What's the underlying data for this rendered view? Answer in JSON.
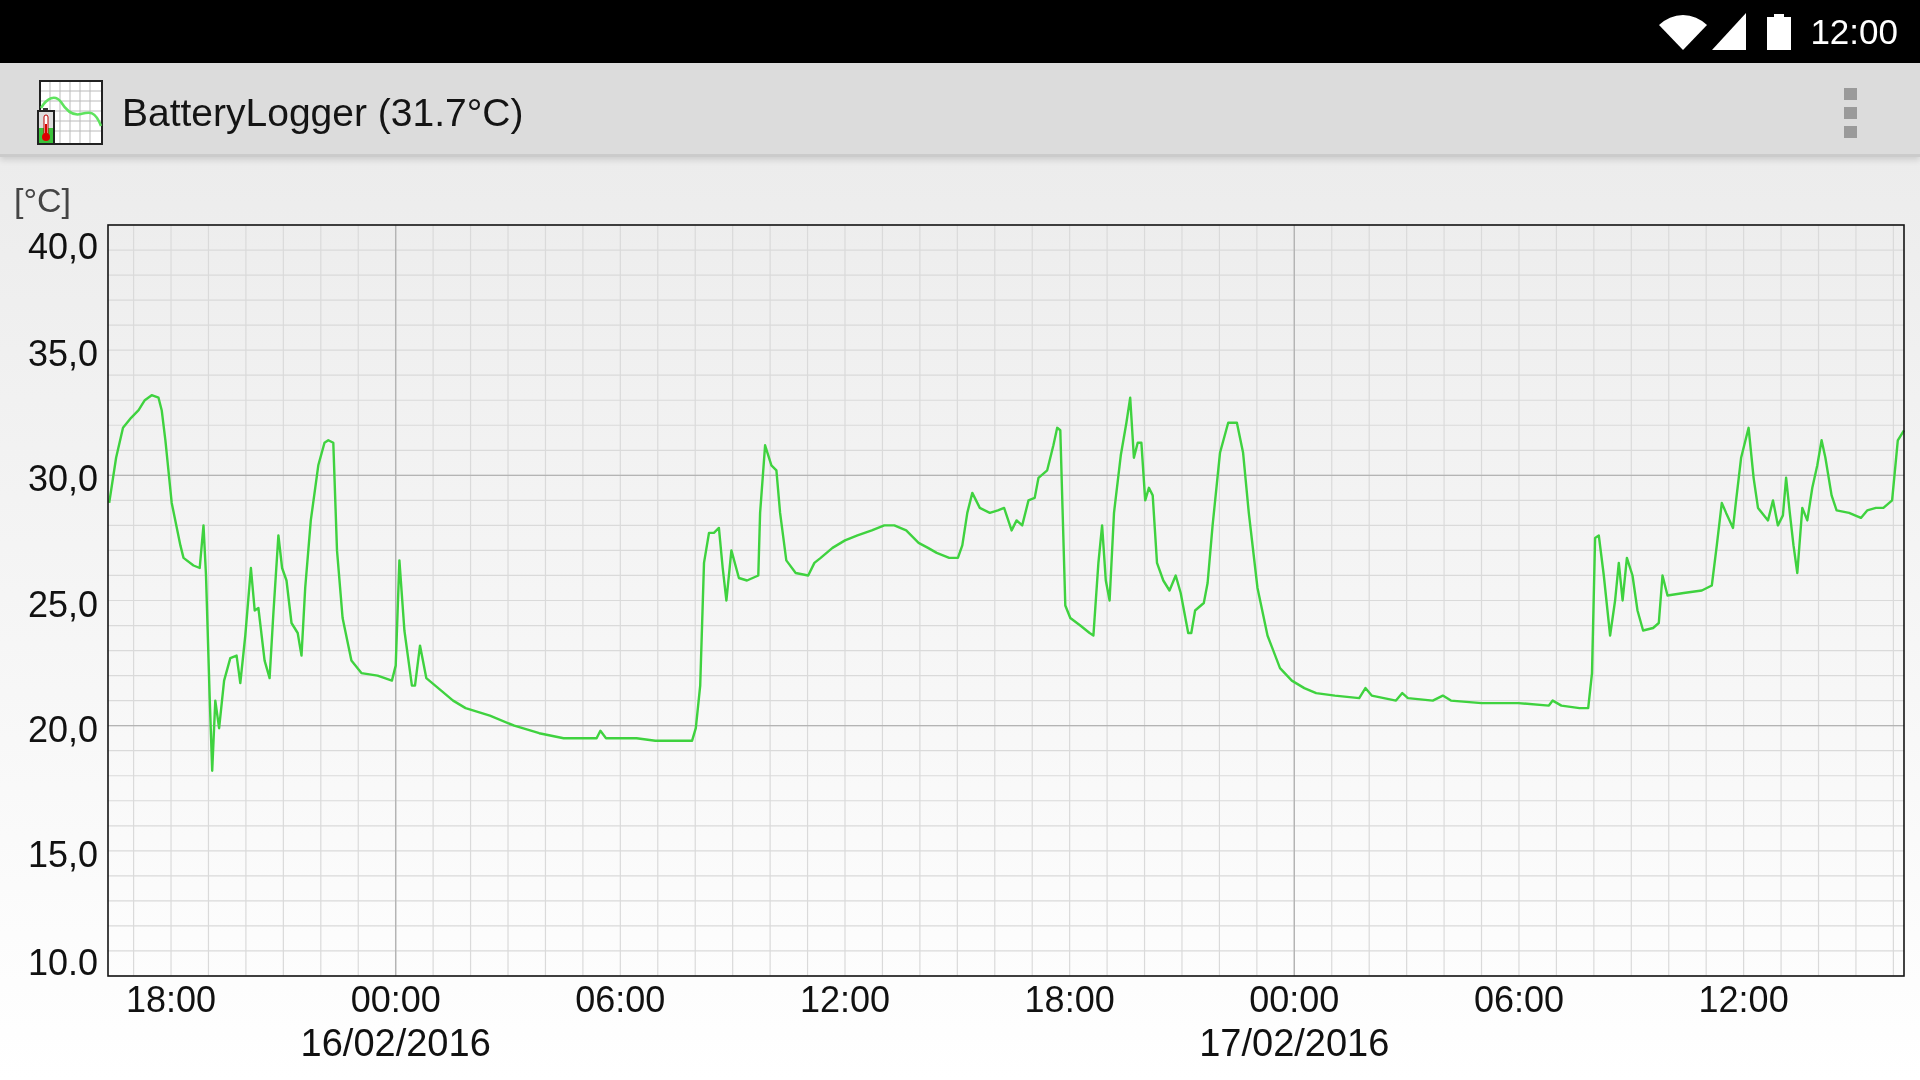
{
  "status_bar": {
    "time": "12:00"
  },
  "app_bar": {
    "title": "BatteryLogger (31.7°C)"
  },
  "chart": {
    "chart_data": {
      "type": "line",
      "ylabel": "[°C]",
      "grid": true,
      "x": [
        "2016-02-15T16:21",
        "2016-02-15T16:32",
        "2016-02-15T16:43",
        "2016-02-15T16:56",
        "2016-02-15T17:08",
        "2016-02-15T17:18",
        "2016-02-15T17:29",
        "2016-02-15T17:40",
        "2016-02-15T17:45",
        "2016-02-15T17:51",
        "2016-02-15T18:01",
        "2016-02-15T18:15",
        "2016-02-15T18:20",
        "2016-02-15T18:36",
        "2016-02-15T18:46",
        "2016-02-15T18:52",
        "2016-02-15T18:56",
        "2016-02-15T19:02",
        "2016-02-15T19:06",
        "2016-02-15T19:11",
        "2016-02-15T19:17",
        "2016-02-15T19:25",
        "2016-02-15T19:35",
        "2016-02-15T19:45",
        "2016-02-15T19:51",
        "2016-02-15T19:59",
        "2016-02-15T20:08",
        "2016-02-15T20:14",
        "2016-02-15T20:20",
        "2016-02-15T20:30",
        "2016-02-15T20:38",
        "2016-02-15T20:44",
        "2016-02-15T20:52",
        "2016-02-15T20:58",
        "2016-02-15T21:05",
        "2016-02-15T21:13",
        "2016-02-15T21:23",
        "2016-02-15T21:29",
        "2016-02-15T21:35",
        "2016-02-15T21:44",
        "2016-02-15T21:56",
        "2016-02-15T22:06",
        "2016-02-15T22:12",
        "2016-02-15T22:20",
        "2016-02-15T22:26",
        "2016-02-15T22:35",
        "2016-02-15T22:49",
        "2016-02-15T23:05",
        "2016-02-15T23:31",
        "2016-02-15T23:54",
        "2016-02-16T00:00",
        "2016-02-16T00:06",
        "2016-02-16T00:14",
        "2016-02-16T00:26",
        "2016-02-16T00:31",
        "2016-02-16T00:39",
        "2016-02-16T00:49",
        "2016-02-16T01:13",
        "2016-02-16T01:32",
        "2016-02-16T01:52",
        "2016-02-16T02:31",
        "2016-02-16T03:10",
        "2016-02-16T03:50",
        "2016-02-16T04:29",
        "2016-02-16T05:22",
        "2016-02-16T05:28",
        "2016-02-16T05:37",
        "2016-02-16T06:26",
        "2016-02-16T06:56",
        "2016-02-16T07:41",
        "2016-02-16T07:55",
        "2016-02-16T08:01",
        "2016-02-16T08:08",
        "2016-02-16T08:14",
        "2016-02-16T08:22",
        "2016-02-16T08:30",
        "2016-02-16T08:38",
        "2016-02-16T08:44",
        "2016-02-16T08:50",
        "2016-02-16T08:58",
        "2016-02-16T09:10",
        "2016-02-16T09:23",
        "2016-02-16T09:41",
        "2016-02-16T09:44",
        "2016-02-16T09:52",
        "2016-02-16T10:02",
        "2016-02-16T10:10",
        "2016-02-16T10:16",
        "2016-02-16T10:26",
        "2016-02-16T10:41",
        "2016-02-16T11:01",
        "2016-02-16T11:11",
        "2016-02-16T11:21",
        "2016-02-16T11:40",
        "2016-02-16T12:00",
        "2016-02-16T12:20",
        "2016-02-16T12:43",
        "2016-02-16T13:03",
        "2016-02-16T13:19",
        "2016-02-16T13:38",
        "2016-02-16T13:58",
        "2016-02-16T14:13",
        "2016-02-16T14:27",
        "2016-02-16T14:47",
        "2016-02-16T15:01",
        "2016-02-16T15:08",
        "2016-02-16T15:16",
        "2016-02-16T15:24",
        "2016-02-16T15:36",
        "2016-02-16T15:52",
        "2016-02-16T16:05",
        "2016-02-16T16:15",
        "2016-02-16T16:27",
        "2016-02-16T16:35",
        "2016-02-16T16:44",
        "2016-02-16T16:54",
        "2016-02-16T17:04",
        "2016-02-16T17:10",
        "2016-02-16T17:24",
        "2016-02-16T17:34",
        "2016-02-16T17:40",
        "2016-02-16T17:45",
        "2016-02-16T17:53",
        "2016-02-16T18:01",
        "2016-02-16T18:17",
        "2016-02-16T18:32",
        "2016-02-16T18:38",
        "2016-02-16T18:46",
        "2016-02-16T18:52",
        "2016-02-16T18:58",
        "2016-02-16T19:04",
        "2016-02-16T19:11",
        "2016-02-16T19:22",
        "2016-02-16T19:31",
        "2016-02-16T19:37",
        "2016-02-16T19:43",
        "2016-02-16T19:49",
        "2016-02-16T19:55",
        "2016-02-16T20:01",
        "2016-02-16T20:07",
        "2016-02-16T20:13",
        "2016-02-16T20:20",
        "2016-02-16T20:30",
        "2016-02-16T20:40",
        "2016-02-16T20:50",
        "2016-02-16T20:58",
        "2016-02-16T21:10",
        "2016-02-16T21:15",
        "2016-02-16T21:21",
        "2016-02-16T21:35",
        "2016-02-16T21:41",
        "2016-02-16T21:49",
        "2016-02-16T22:01",
        "2016-02-16T22:14",
        "2016-02-16T22:28",
        "2016-02-16T22:38",
        "2016-02-16T22:47",
        "2016-02-16T23:01",
        "2016-02-16T23:17",
        "2016-02-16T23:37",
        "2016-02-16T23:56",
        "2016-02-17T00:16",
        "2016-02-17T00:35",
        "2016-02-17T01:05",
        "2016-02-17T01:44",
        "2016-02-17T01:54",
        "2016-02-17T02:04",
        "2016-02-17T02:43",
        "2016-02-17T02:53",
        "2016-02-17T03:02",
        "2016-02-17T03:42",
        "2016-02-17T03:58",
        "2016-02-17T04:11",
        "2016-02-17T05:00",
        "2016-02-17T05:59",
        "2016-02-17T06:48",
        "2016-02-17T06:54",
        "2016-02-17T07:08",
        "2016-02-17T07:37",
        "2016-02-17T07:51",
        "2016-02-17T07:57",
        "2016-02-17T08:02",
        "2016-02-17T08:08",
        "2016-02-17T08:16",
        "2016-02-17T08:26",
        "2016-02-17T08:34",
        "2016-02-17T08:40",
        "2016-02-17T08:46",
        "2016-02-17T08:53",
        "2016-02-17T09:02",
        "2016-02-17T09:10",
        "2016-02-17T09:19",
        "2016-02-17T09:35",
        "2016-02-17T09:44",
        "2016-02-17T09:50",
        "2016-02-17T09:58",
        "2016-02-17T10:24",
        "2016-02-17T10:53",
        "2016-02-17T11:09",
        "2016-02-17T11:17",
        "2016-02-17T11:25",
        "2016-02-17T11:32",
        "2016-02-17T11:43",
        "2016-02-17T11:48",
        "2016-02-17T11:56",
        "2016-02-17T12:08",
        "2016-02-17T12:16",
        "2016-02-17T12:23",
        "2016-02-17T12:39",
        "2016-02-17T12:47",
        "2016-02-17T12:55",
        "2016-02-17T13:03",
        "2016-02-17T13:08",
        "2016-02-17T13:14",
        "2016-02-17T13:20",
        "2016-02-17T13:26",
        "2016-02-17T13:34",
        "2016-02-17T13:42",
        "2016-02-17T13:50",
        "2016-02-17T13:58",
        "2016-02-17T14:05",
        "2016-02-17T14:11",
        "2016-02-17T14:21",
        "2016-02-17T14:29",
        "2016-02-17T14:49",
        "2016-02-17T15:08",
        "2016-02-17T15:18",
        "2016-02-17T15:32",
        "2016-02-17T15:44",
        "2016-02-17T15:58",
        "2016-02-17T16:07",
        "2016-02-17T16:17"
      ],
      "values": [
        28.9,
        30.7,
        31.9,
        32.3,
        32.6,
        33.0,
        33.2,
        33.1,
        32.6,
        31.4,
        28.9,
        27.2,
        26.7,
        26.4,
        26.3,
        28.0,
        26.0,
        21.1,
        18.2,
        21.0,
        19.9,
        21.8,
        22.7,
        22.8,
        21.7,
        23.6,
        26.3,
        24.6,
        24.7,
        22.6,
        21.9,
        24.5,
        27.6,
        26.3,
        25.8,
        24.1,
        23.7,
        22.8,
        25.5,
        28.2,
        30.4,
        31.3,
        31.4,
        31.3,
        27.0,
        24.3,
        22.6,
        22.1,
        22.0,
        21.8,
        22.4,
        26.6,
        23.8,
        21.6,
        21.6,
        23.2,
        21.9,
        21.4,
        21.0,
        20.7,
        20.4,
        20.0,
        19.7,
        19.5,
        19.5,
        19.8,
        19.5,
        19.5,
        19.4,
        19.4,
        19.4,
        19.9,
        21.6,
        26.5,
        27.7,
        27.7,
        27.9,
        26.3,
        25.0,
        27.0,
        25.9,
        25.8,
        26.0,
        28.5,
        31.2,
        30.4,
        30.2,
        28.5,
        26.6,
        26.1,
        26.0,
        26.5,
        26.7,
        27.1,
        27.4,
        27.6,
        27.8,
        28.0,
        28.0,
        27.8,
        27.3,
        27.1,
        26.9,
        26.7,
        26.7,
        27.2,
        28.5,
        29.3,
        28.7,
        28.5,
        28.6,
        28.7,
        27.8,
        28.2,
        28.0,
        29.0,
        29.1,
        29.9,
        30.2,
        31.2,
        31.9,
        31.8,
        24.8,
        24.3,
        24.0,
        23.7,
        23.6,
        26.5,
        28.0,
        25.8,
        25.0,
        28.5,
        30.8,
        32.1,
        33.1,
        30.7,
        31.3,
        31.3,
        29.0,
        29.5,
        29.2,
        26.5,
        25.8,
        25.4,
        26.0,
        25.3,
        23.7,
        23.7,
        24.6,
        24.9,
        25.7,
        28.0,
        30.9,
        32.1,
        32.1,
        30.9,
        28.5,
        25.5,
        23.6,
        22.3,
        21.8,
        21.5,
        21.3,
        21.2,
        21.1,
        21.5,
        21.2,
        21.0,
        21.3,
        21.1,
        21.0,
        21.2,
        21.0,
        20.9,
        20.9,
        20.8,
        21.0,
        20.8,
        20.7,
        20.7,
        22.1,
        27.5,
        27.6,
        26.0,
        23.6,
        25.0,
        26.5,
        25.0,
        26.7,
        26.0,
        24.6,
        23.8,
        23.9,
        24.1,
        26.0,
        25.2,
        25.3,
        25.4,
        25.6,
        27.2,
        28.9,
        28.5,
        27.9,
        29.0,
        30.7,
        31.9,
        29.9,
        28.7,
        28.2,
        29.0,
        28.0,
        28.4,
        29.9,
        28.5,
        27.2,
        26.1,
        28.7,
        28.2,
        29.5,
        30.4,
        31.4,
        30.7,
        29.2,
        28.6,
        28.5,
        28.3,
        28.6,
        28.7,
        28.7,
        29.0,
        31.4,
        31.8
      ],
      "xlim": [
        "2016-02-15T16:19",
        "2016-02-17T16:17"
      ],
      "ylim": [
        10,
        40
      ],
      "xticks": [
        {
          "value": "2016-02-15T18:00",
          "label": "18:00"
        },
        {
          "value": "2016-02-16T00:00",
          "label": "00:00"
        },
        {
          "value": "2016-02-16T06:00",
          "label": "06:00"
        },
        {
          "value": "2016-02-16T12:00",
          "label": "12:00"
        },
        {
          "value": "2016-02-16T18:00",
          "label": "18:00"
        },
        {
          "value": "2016-02-17T00:00",
          "label": "00:00"
        },
        {
          "value": "2016-02-17T06:00",
          "label": "06:00"
        },
        {
          "value": "2016-02-17T12:00",
          "label": "12:00"
        }
      ],
      "yticks": [
        {
          "value": 40,
          "label": "40,0"
        },
        {
          "value": 35,
          "label": "35,0"
        },
        {
          "value": 30,
          "label": "30,0"
        },
        {
          "value": 25,
          "label": "25,0"
        },
        {
          "value": 20,
          "label": "20,0"
        },
        {
          "value": 15,
          "label": "15,0"
        },
        {
          "value": 10,
          "label": "10.0"
        }
      ],
      "annotations": [
        "16/02/2016",
        "17/02/2016"
      ]
    }
  }
}
